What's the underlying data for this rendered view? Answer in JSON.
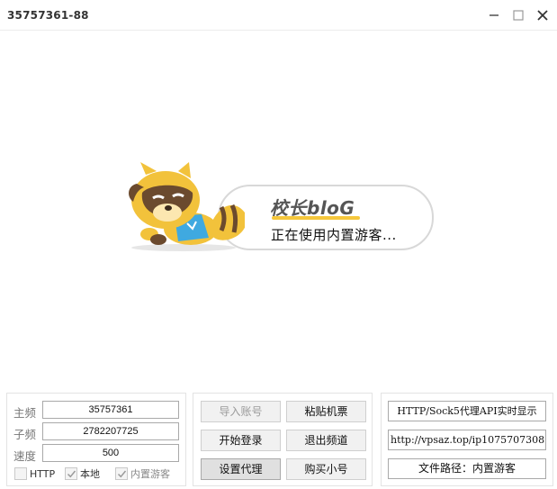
{
  "window": {
    "title": "35757361-88"
  },
  "splash": {
    "brand": "校长bloG",
    "status": "正在使用内置游客...",
    "brand_color": "#f5c73c"
  },
  "fields": {
    "main_label": "主频",
    "main_value": "35757361",
    "sub_label": "子频",
    "sub_value": "2782207725",
    "speed_label": "速度",
    "speed_value": "500"
  },
  "checkboxes": [
    {
      "label": "HTTP",
      "checked": false
    },
    {
      "label": "本地",
      "checked": true
    },
    {
      "label": "内置游客",
      "checked": true
    }
  ],
  "buttons": {
    "import_account": "导入账号",
    "paste_ticket": "粘贴机票",
    "start_login": "开始登录",
    "exit_channel": "退出频道",
    "set_proxy": "设置代理",
    "buy_account": "购买小号"
  },
  "right_panel": {
    "api_display": "HTTP/Sock5代理API实时显示",
    "url_value": "http://vpsaz.top/ip1075707308",
    "file_path": "文件路径：内置游客"
  }
}
